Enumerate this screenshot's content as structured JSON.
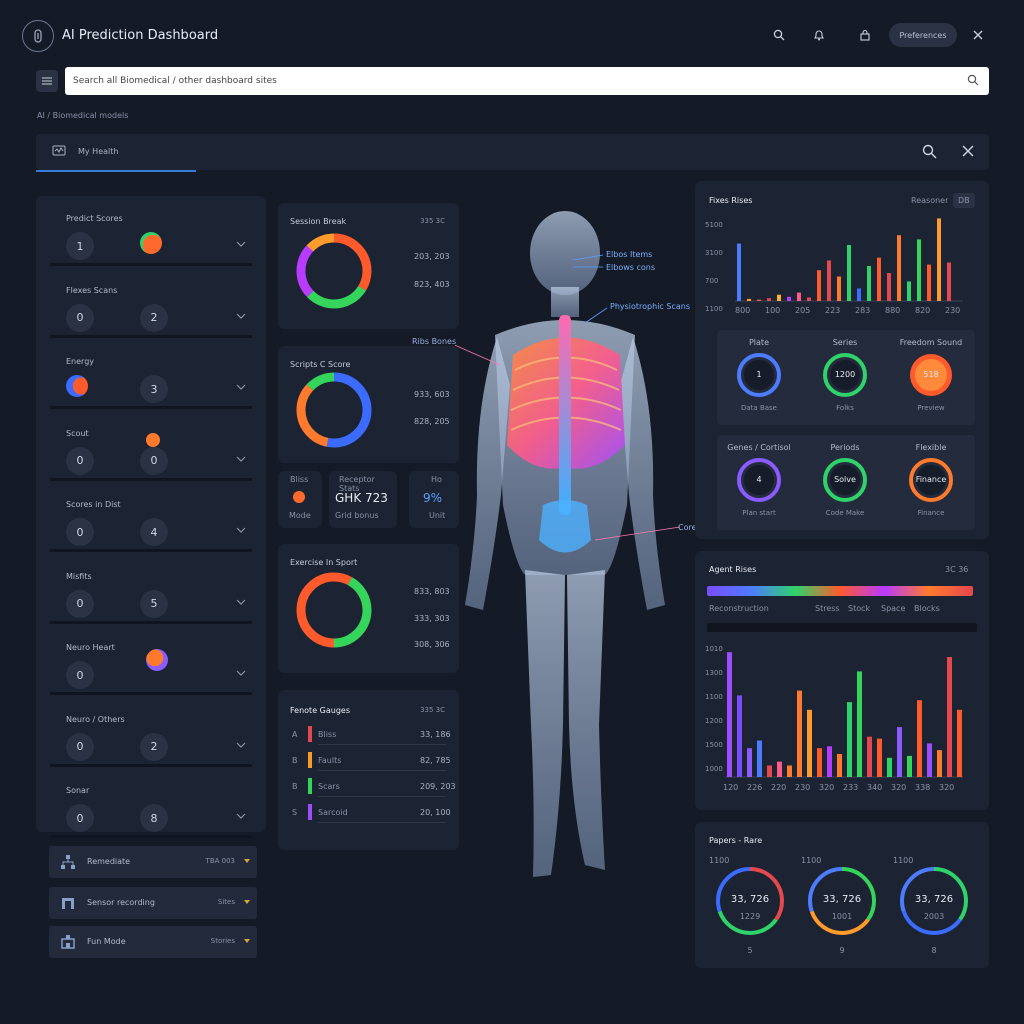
{
  "header": {
    "title": "AI Prediction Dashboard",
    "button_label": "Preferences",
    "icons": [
      "search-icon",
      "bell-icon",
      "lock-icon",
      "close-icon"
    ]
  },
  "search": {
    "placeholder": "Search all Biomedical / other dashboard sites"
  },
  "breadcrumb": "AI / Biomedical models",
  "tab": {
    "label": "My Health"
  },
  "left_list": [
    {
      "label": "Predict Scores",
      "badge": "1",
      "badge2": "",
      "blob": "orange-green"
    },
    {
      "label": "Flexes Scans",
      "badge": "0",
      "badge2": "2",
      "blob": ""
    },
    {
      "label": "Energy",
      "badge": "",
      "badge2": "3",
      "blob": "blue-orange"
    },
    {
      "label": "Scout",
      "badge": "0",
      "badge2": "0",
      "blob": "orange"
    },
    {
      "label": "Scores in Dist",
      "badge": "0",
      "badge2": "4",
      "blob": ""
    },
    {
      "label": "Misfits",
      "badge": "0",
      "badge2": "5",
      "blob": ""
    },
    {
      "label": "Neuro Heart",
      "badge": "0",
      "badge2": "",
      "blob": "orange-purple"
    },
    {
      "label": "Neuro / Others",
      "badge": "0",
      "badge2": "2",
      "blob": ""
    },
    {
      "label": "Sonar",
      "badge": "0",
      "badge2": "8",
      "blob": ""
    }
  ],
  "bottom_buttons": [
    {
      "label": "Remediate",
      "value": "TBA 003"
    },
    {
      "label": "Sensor recording",
      "value": "Sites"
    },
    {
      "label": "Fun Mode",
      "value": "Stories"
    }
  ],
  "cards": {
    "donut1": {
      "title": "Session Break",
      "meta": "335 3C",
      "v1": "203, 203",
      "v2": "823, 403"
    },
    "donut2": {
      "title": "Scripts C Score",
      "meta": "",
      "v1": "933, 603",
      "v2": "828, 205"
    },
    "mini": {
      "a_label": "Bliss",
      "a_sub": "Mode",
      "b_label": "Receptor Stats",
      "b_value": "GHK 723",
      "b_sub": "Grid bonus",
      "c_label": "Ho",
      "c_value": "9%",
      "c_sub": "Unit"
    },
    "donut3": {
      "title": "Exercise In Sport",
      "meta": "",
      "v1": "833, 803",
      "v2": "333, 303",
      "v3": "308, 306"
    },
    "list": {
      "title": "Fenote Gauges",
      "meta": "335 3C",
      "rows": [
        {
          "num": "A",
          "label": "Bliss",
          "value": "33, 186",
          "color": "#e5484d"
        },
        {
          "num": "B",
          "label": "Faults",
          "value": "82, 785",
          "color": "#f59e2c"
        },
        {
          "num": "B",
          "label": "Scars",
          "value": "209, 203",
          "color": "#35d45a"
        },
        {
          "num": "S",
          "label": "Sarcoid",
          "value": "20, 100",
          "color": "#9b4dff"
        }
      ]
    }
  },
  "body": {
    "annotations": [
      "Elbos Items",
      "Elbows cons",
      "Physiotrophic Scans",
      "Ribs Bones",
      "Core/Sacrum"
    ]
  },
  "panel_bars": {
    "title": "Fixes Rises",
    "meta": "Reasoner",
    "meta2": "DB",
    "y_ticks": [
      "5100",
      "3100",
      "700",
      "1100"
    ],
    "x_ticks": [
      "800",
      "100",
      "205",
      "223",
      "283",
      "880",
      "820",
      "230"
    ]
  },
  "gauges1": [
    {
      "title": "Plate",
      "value": "1",
      "sub": "Data Base",
      "color": "#4d7cff"
    },
    {
      "title": "Series",
      "value": "1200",
      "sub": "Folks",
      "color": "#2fd36a"
    },
    {
      "title": "Freedom Sound",
      "value": "518",
      "sub": "Preview",
      "color": "#ff5a2c"
    }
  ],
  "gauges2": [
    {
      "title": "Genes / Cortisol",
      "value": "4",
      "sub": "Plan start",
      "color": "#8a5bff"
    },
    {
      "title": "Periods",
      "value": "Solve",
      "sub": "Code Make",
      "color": "#2fd36a"
    },
    {
      "title": "Flexible",
      "value": "Finance",
      "sub": "Finance",
      "color": "#ff7a2c"
    }
  ],
  "panel_age": {
    "title": "Agent Rises",
    "meta": "3C 36",
    "labels": [
      "Reconstruction",
      "Stress",
      "Stock",
      "Space",
      "Blocks"
    ],
    "y_ticks": [
      "1010",
      "1300",
      "1100",
      "1200",
      "1500",
      "1000"
    ],
    "x_ticks": [
      "120",
      "226",
      "220",
      "230",
      "320",
      "233",
      "340",
      "320",
      "338",
      "320"
    ]
  },
  "panel_rings": {
    "title": "Papers - Rare",
    "rings": [
      {
        "top": "1100",
        "value": "33, 726",
        "sub": "1229",
        "bottom": "5"
      },
      {
        "top": "1100",
        "value": "33, 726",
        "sub": "1001",
        "bottom": "9"
      },
      {
        "top": "1100",
        "value": "33, 726",
        "sub": "2003",
        "bottom": "8"
      }
    ]
  },
  "colors": {
    "bg": "#141a26",
    "panel": "#1c2332",
    "accent": "#3a7bd5"
  }
}
